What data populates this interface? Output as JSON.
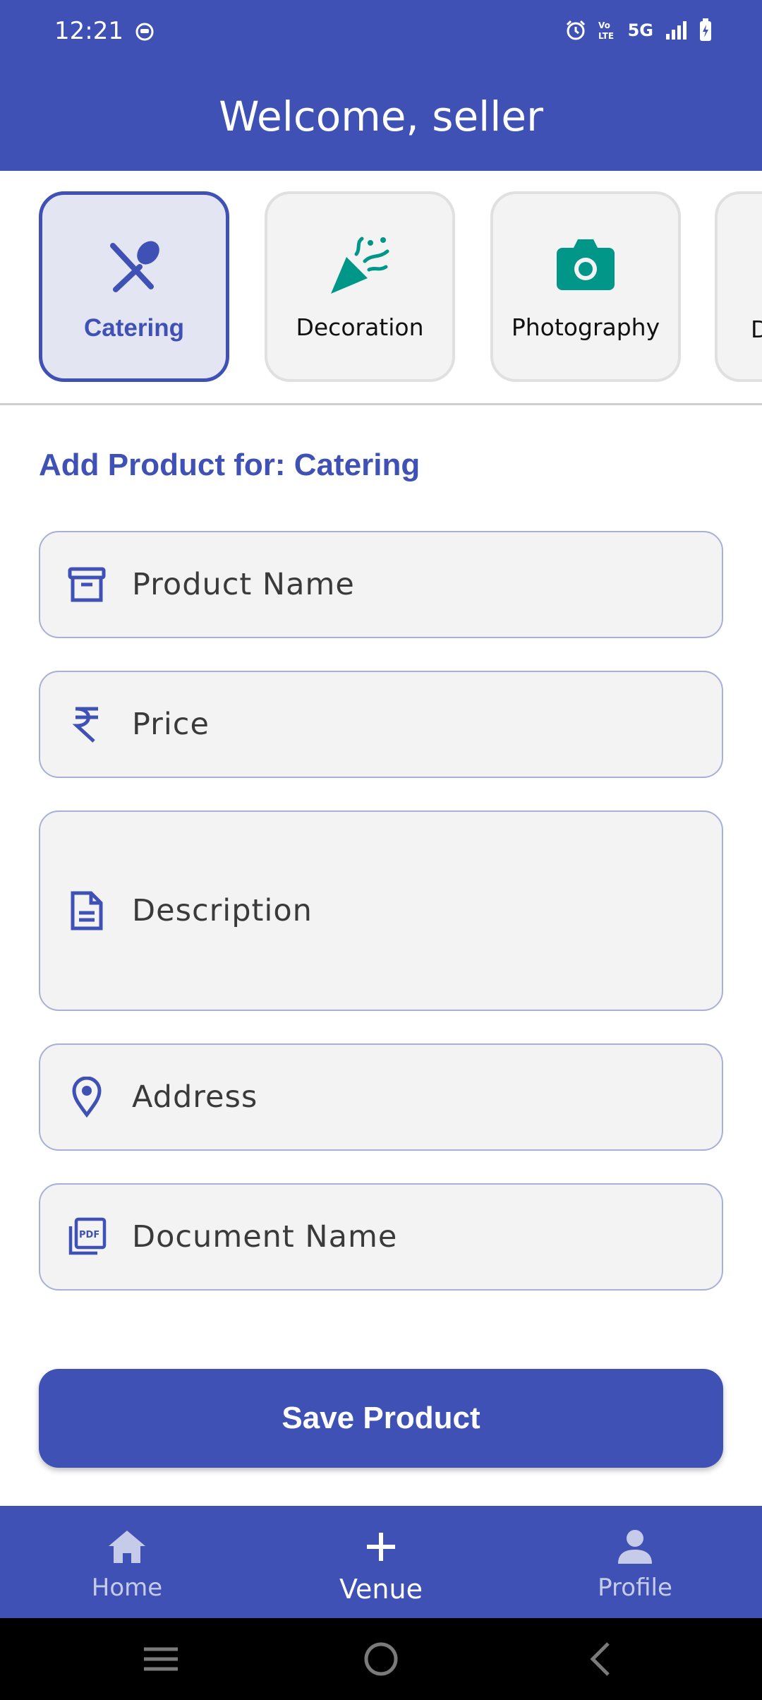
{
  "status_bar": {
    "time": "12:21",
    "network": "5G"
  },
  "app_bar": {
    "title": "Welcome, seller"
  },
  "categories": [
    {
      "label": "Catering",
      "icon": "fork-spoon-icon",
      "selected": true
    },
    {
      "label": "Decoration",
      "icon": "party-popper-icon",
      "selected": false
    },
    {
      "label": "Photography",
      "icon": "camera-icon",
      "selected": false
    },
    {
      "label": "D",
      "icon": "unknown-icon",
      "selected": false
    }
  ],
  "form": {
    "heading": "Add Product for: Catering",
    "fields": {
      "product_name": {
        "placeholder": "Product Name",
        "icon": "archive-box-icon"
      },
      "price": {
        "placeholder": "Price",
        "icon": "rupee-icon"
      },
      "description": {
        "placeholder": "Description",
        "icon": "document-icon"
      },
      "address": {
        "placeholder": "Address",
        "icon": "location-pin-icon"
      },
      "document_name": {
        "placeholder": "Document Name",
        "icon": "pdf-icon"
      }
    },
    "save_label": "Save Product"
  },
  "bottom_nav": {
    "items": [
      {
        "label": "Home",
        "icon": "home-icon",
        "active": false
      },
      {
        "label": "Venue",
        "icon": "plus-icon",
        "active": true
      },
      {
        "label": "Profile",
        "icon": "person-icon",
        "active": false
      }
    ]
  },
  "colors": {
    "primary": "#3f51b5",
    "selected_card_bg": "#e3e5f3",
    "accent_teal": "#009688",
    "field_bg": "#f3f3f3"
  }
}
